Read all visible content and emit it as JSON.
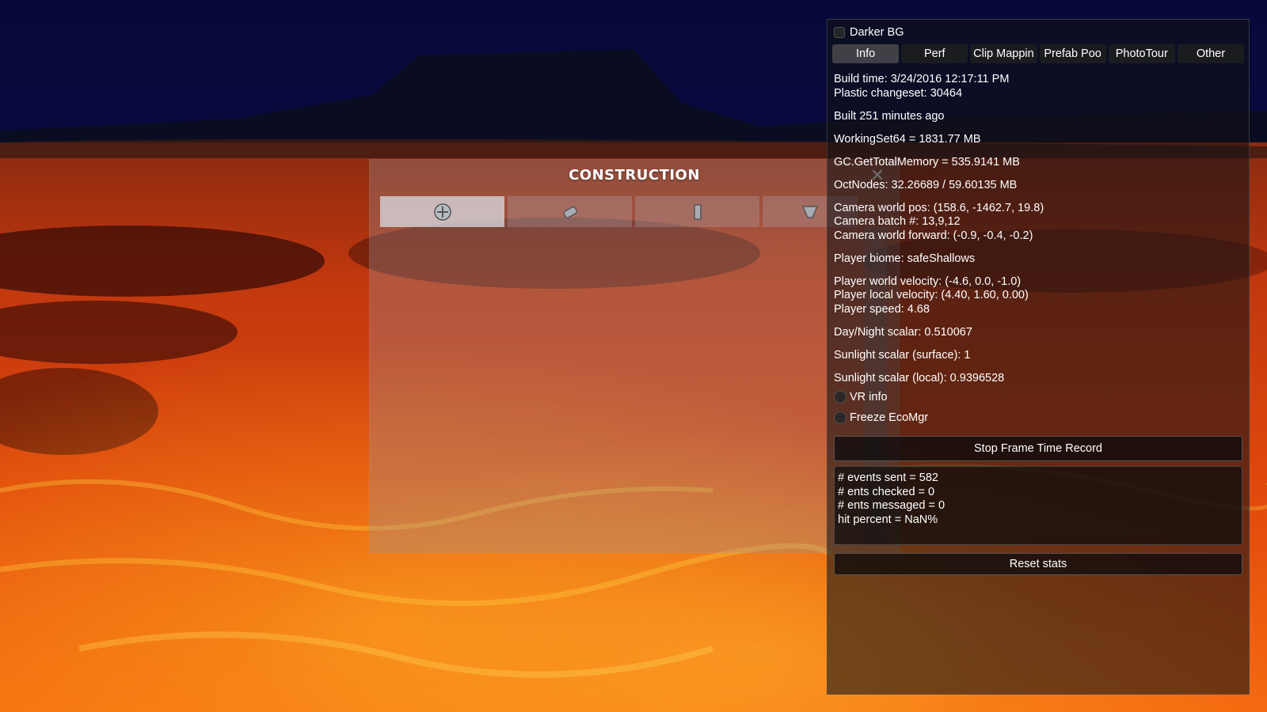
{
  "construction": {
    "title": "CONSTRUCTION",
    "close_glyph": "✕",
    "tabs": [
      {
        "icon": "base-pieces-icon",
        "active": true
      },
      {
        "icon": "exterior-modules-icon",
        "active": false
      },
      {
        "icon": "interior-pieces-icon",
        "active": false
      },
      {
        "icon": "interior-modules-icon",
        "active": false
      }
    ]
  },
  "debug": {
    "darker_bg_label": "Darker BG",
    "tabs": [
      "Info",
      "Perf",
      "Clip Mappin",
      "Prefab Poo",
      "PhotoTour",
      "Other"
    ],
    "active_tab": "Info",
    "build_time": "Build time: 3/24/2016 12:17:11 PM",
    "changeset": "Plastic changeset: 30464",
    "built_ago": "Built 251 minutes ago",
    "working_set": "WorkingSet64 = 1831.77 MB",
    "gc_memory": "GC.GetTotalMemory = 535.9141 MB",
    "oct_nodes": "OctNodes: 32.26689 / 59.60135 MB",
    "camera_pos": "Camera world pos: (158.6, -1462.7, 19.8)",
    "camera_batch": "Camera batch #: 13,9,12",
    "camera_forward": "Camera world forward: (-0.9, -0.4, -0.2)",
    "player_biome": "Player biome: safeShallows",
    "player_world_velocity": "Player world velocity: (-4.6, 0.0, -1.0)",
    "player_local_velocity": "Player local velocity: (4.40, 1.60, 0.00)",
    "player_speed": "Player speed: 4.68",
    "day_night": "Day/Night scalar: 0.510067",
    "sunlight_surface": "Sunlight scalar (surface): 1",
    "sunlight_local": "Sunlight scalar (local): 0.9396528",
    "vr_info_label": "VR info",
    "freeze_ecomgr_label": "Freeze EcoMgr",
    "stop_frame_button": "Stop Frame Time Record",
    "stats": [
      "# events sent = 582",
      "# ents checked = 0",
      "# ents messaged = 0",
      "hit percent = NaN%"
    ],
    "reset_button": "Reset stats"
  }
}
